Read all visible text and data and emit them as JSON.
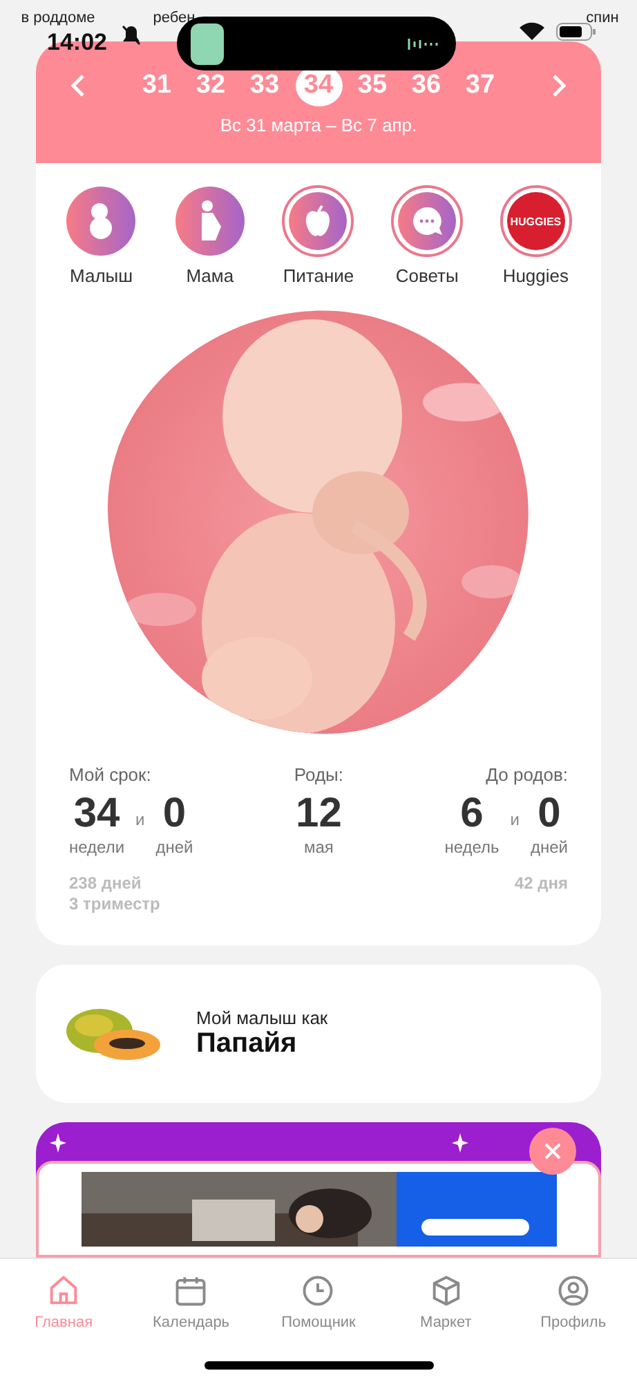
{
  "stories": [
    {
      "lines": [
        "в роддоме"
      ]
    },
    {
      "lines": [
        "ребен"
      ]
    },
    {
      "lines": [
        "спин"
      ]
    }
  ],
  "status_bar": {
    "time": "14:02",
    "muted": true
  },
  "week_picker": {
    "weeks": [
      {
        "label": "31",
        "selected": false
      },
      {
        "label": "32",
        "selected": false
      },
      {
        "label": "33",
        "selected": false
      },
      {
        "label": "34",
        "selected": true
      },
      {
        "label": "35",
        "selected": false
      },
      {
        "label": "36",
        "selected": false
      },
      {
        "label": "37",
        "selected": false
      }
    ],
    "range": "Вс 31 марта – Вс 7 апр."
  },
  "categories": [
    {
      "label": "Малыш",
      "kind": "baby",
      "ringed": false
    },
    {
      "label": "Мама",
      "kind": "mom",
      "ringed": false
    },
    {
      "label": "Питание",
      "kind": "food",
      "ringed": true
    },
    {
      "label": "Советы",
      "kind": "tips",
      "ringed": true
    },
    {
      "label": "Huggies",
      "kind": "brand",
      "badge": "HUGGIES",
      "ringed": true
    }
  ],
  "stats": [
    {
      "title": "Мой срок:",
      "values": [
        {
          "number": "34",
          "unit": "недели"
        },
        {
          "number": "0",
          "unit": "дней"
        }
      ],
      "joiner": "и",
      "notes": [
        "238 дней",
        "3 триместр"
      ]
    },
    {
      "title": "Роды:",
      "values": [
        {
          "number": "12",
          "unit": "мая"
        }
      ]
    },
    {
      "title": "До родов:",
      "values": [
        {
          "number": "6",
          "unit": "недель"
        },
        {
          "number": "0",
          "unit": "дней"
        }
      ],
      "joiner": "и",
      "notes": [
        "42 дня"
      ]
    }
  ],
  "fruit": {
    "caption": "Мой малыш как",
    "name": "Папайя"
  },
  "nav": [
    {
      "label": "Главная",
      "kind": "home",
      "selected": true
    },
    {
      "label": "Календарь",
      "kind": "calendar",
      "selected": false
    },
    {
      "label": "Помощник",
      "kind": "clock",
      "selected": false
    },
    {
      "label": "Маркет",
      "kind": "box",
      "selected": false
    },
    {
      "label": "Профиль",
      "kind": "profile",
      "selected": false
    }
  ]
}
